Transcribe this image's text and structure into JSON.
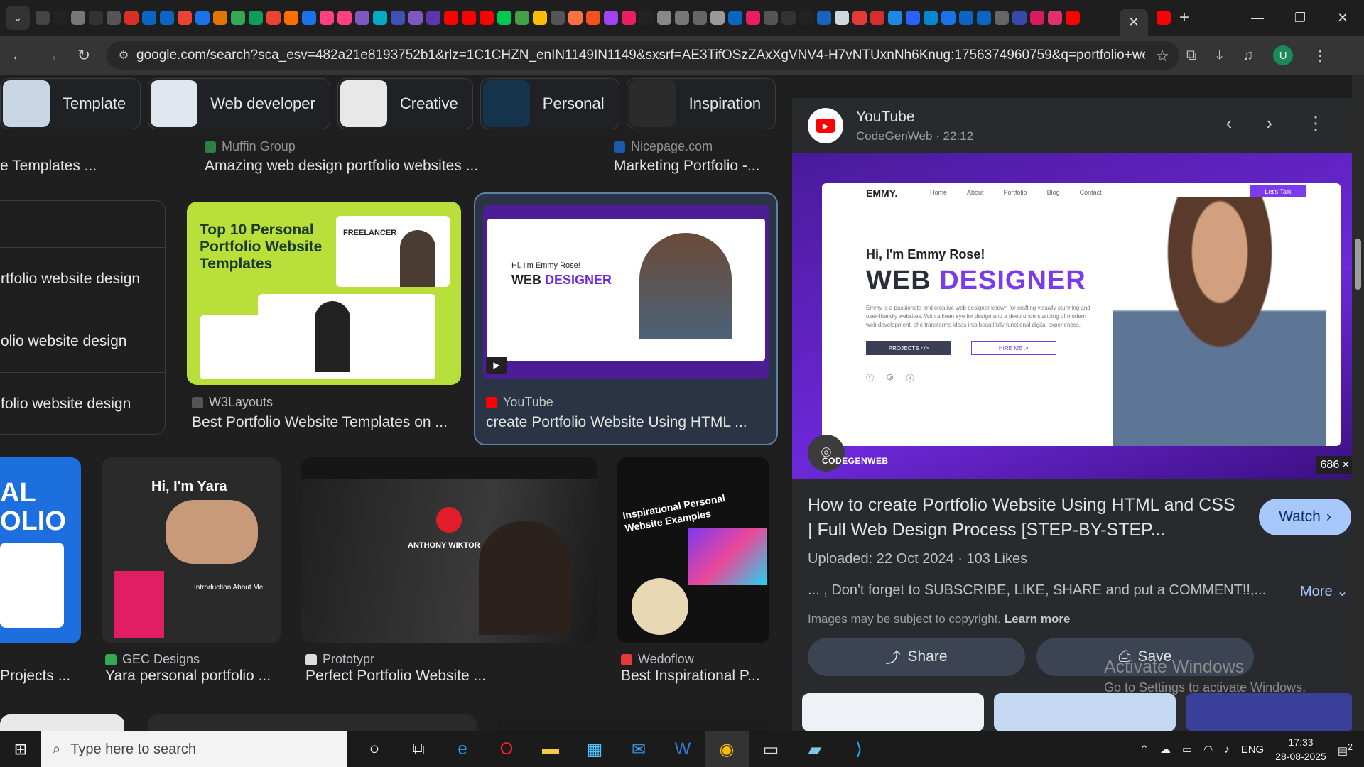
{
  "browser": {
    "tab_close": "✕",
    "new_tab": "+",
    "url": "google.com/search?sca_esv=482a21e8193752b1&rlz=1C1CHZN_enIN1149IN1149&sxsrf=AE3TifOSzZAxXgVNV4-H7vNTUxnNh6Knug:1756374960759&q=portfolio+website+design...",
    "profile_initial": "U",
    "favicon_colors": [
      "#444",
      "#222",
      "#777",
      "#333",
      "#555",
      "#d93025",
      "#0a66c2",
      "#0a66c2",
      "#ea4335",
      "#1a73e8",
      "#e37400",
      "#34a853",
      "#0f9d58",
      "#ea4335",
      "#ff6f00",
      "#1a73e8",
      "#ff4081",
      "#ff4081",
      "#7e57c2",
      "#00acc1",
      "#3f51b5",
      "#7e57c2",
      "#5e35b1",
      "#ff0000",
      "#ff0000",
      "#ff0000",
      "#00c853",
      "#43a047",
      "#fbbc04",
      "#555",
      "#ff7043",
      "#f4511e",
      "#a142f4",
      "#e91e63",
      "#222",
      "#888",
      "#777",
      "#666",
      "#999",
      "#0a66c2",
      "#e91e63",
      "#555",
      "#333",
      "#222",
      "#1565c0",
      "#cfd8dc",
      "#e53935",
      "#d32f2f",
      "#1e88e5",
      "#2962ff",
      "#0288d1",
      "#1a73e8",
      "#0a66c2",
      "#0a66c2",
      "#666",
      "#3949ab",
      "#d81b60",
      "#e1306c",
      "#ff0000"
    ]
  },
  "chips": [
    {
      "label": "Template",
      "color": "#c9d6e3"
    },
    {
      "label": "Web developer",
      "color": "#dfe6ee"
    },
    {
      "label": "Creative",
      "color": "#e8e8e8"
    },
    {
      "label": "Personal",
      "color": "#15334a"
    },
    {
      "label": "Inspiration",
      "color": "#2b2b2b"
    }
  ],
  "results": {
    "top_row_titles": [
      "e Templates ...",
      "Amazing web design portfolio websites ...",
      "Marketing Portfolio -..."
    ],
    "top_row_sources": [
      "Muffin Group",
      "Nicepage.com"
    ],
    "related": [
      "",
      "rtfolio website design",
      "olio website design",
      "folio website design"
    ],
    "r1": {
      "source": "W3Layouts",
      "title": "Best Portfolio Website Templates on ...",
      "thumb_heading": "Top 10 Personal Portfolio Website Templates",
      "thumb_sub": "FREELANCER"
    },
    "r2": {
      "source": "YouTube",
      "title": "create Portfolio Website Using HTML ..."
    },
    "r3": {
      "source": "",
      "title": "Projects ..."
    },
    "r4": {
      "source": "GEC Designs",
      "title": "Yara personal portfolio ...",
      "thumb_text": "Hi, I'm Yara",
      "thumb_sub": "Introduction About Me"
    },
    "r5": {
      "source": "Prototypr",
      "title": "Perfect Portfolio Website ...",
      "thumb_text": "ANTHONY WIKTOR"
    },
    "r6": {
      "source": "Wedoflow",
      "title": "Best Inspirational P...",
      "thumb_text": "Inspirational Personal Website Examples"
    }
  },
  "panel": {
    "channel": "YouTube",
    "meta": "CodeGenWeb · 22:12",
    "brand": "EMMY.",
    "nav": [
      "Home",
      "About",
      "Portfolio",
      "Blog",
      "Contact"
    ],
    "cta": "Let's Talk",
    "greeting": "Hi, I'm Emmy Rose!",
    "role_a": "WEB",
    "role_b": "DESIGNER",
    "intro": "Emmy is a passionate and creative web designer known for crafting visually stunning and user-friendly websites. With a keen eye for design and a deep understanding of modern web development, she transforms ideas into beautifully functional digital experiences.",
    "btn_projects": "PROJECTS </>",
    "btn_hire": "HIRE ME ↗",
    "watermark": "CODEGENWEB",
    "dimensions": "686 ×",
    "title": "How to create Portfolio Website Using HTML and CSS | Full Web Design Process [STEP-BY-STEP...",
    "watch": "Watch",
    "info": "Uploaded: 22 Oct 2024 · 103 Likes",
    "desc": "... , Don't forget to SUBSCRIBE, LIKE, SHARE and put a COMMENT!!,...",
    "more": "More",
    "copyright": "Images may be subject to copyright.",
    "learn_more": "Learn more",
    "share": "Share",
    "save": "Save"
  },
  "overlay": {
    "activate": "Activate Windows",
    "activate_sub": "Go to Settings to activate Windows."
  },
  "taskbar": {
    "search_placeholder": "Type here to search",
    "lang": "ENG",
    "time": "17:33",
    "date": "28-08-2025",
    "notif_count": "2"
  }
}
